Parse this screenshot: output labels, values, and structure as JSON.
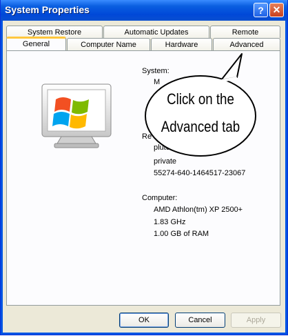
{
  "window": {
    "title": "System Properties",
    "help_glyph": "?",
    "close_glyph": "✕"
  },
  "tabs_row1": [
    {
      "label": "System Restore"
    },
    {
      "label": "Automatic Updates"
    },
    {
      "label": "Remote"
    }
  ],
  "tabs_row2": [
    {
      "label": "General",
      "active": true
    },
    {
      "label": "Computer Name"
    },
    {
      "label": "Hardware"
    },
    {
      "label": "Advanced"
    }
  ],
  "general": {
    "system_label": "System:",
    "system_partial": "M",
    "registered_label_partial": "Re",
    "registered_name_partial": "plutc",
    "organization": "private",
    "product_id": "55274-640-1464517-23067",
    "computer_label": "Computer:",
    "cpu": "AMD Athlon(tm) XP 2500+",
    "speed": "1.83 GHz",
    "ram": "1.00 GB of RAM"
  },
  "callout": {
    "line1": "Click on the",
    "line2": "Advanced tab"
  },
  "buttons": {
    "ok": "OK",
    "cancel": "Cancel",
    "apply": "Apply"
  },
  "colors": {
    "titlebar": "#0054e3",
    "dialog": "#ece9d8",
    "tab_highlight": "#ffc73c"
  }
}
